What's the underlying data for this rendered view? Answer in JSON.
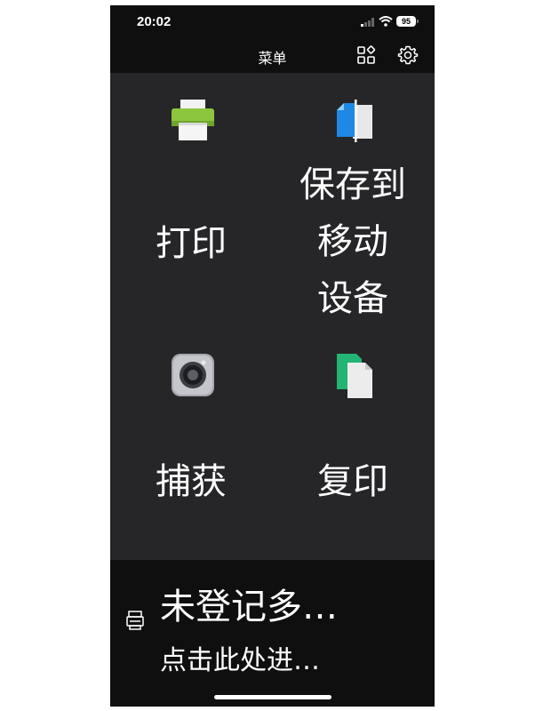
{
  "status_bar": {
    "time": "20:02",
    "battery": "95"
  },
  "header": {
    "title": "菜单",
    "icons": [
      "apps-grid-icon",
      "settings-gear-icon"
    ]
  },
  "menu": {
    "tiles": [
      {
        "label": "打印",
        "icon": "printer-icon"
      },
      {
        "label": "保存到移动设备",
        "icon": "save-to-device-icon"
      },
      {
        "label": "捕获",
        "icon": "camera-icon"
      },
      {
        "label": "复印",
        "icon": "copy-document-icon"
      }
    ]
  },
  "device_bar": {
    "icon": "printer-device-icon",
    "title": "未登记多…",
    "subtitle": "点击此处进…"
  },
  "colors": {
    "background": "#262629",
    "bars": "#0f0f10",
    "text": "#ffffff",
    "printer_accent": "#8cc63f",
    "save_accent": "#1e88e5",
    "copy_accent": "#22b573"
  }
}
